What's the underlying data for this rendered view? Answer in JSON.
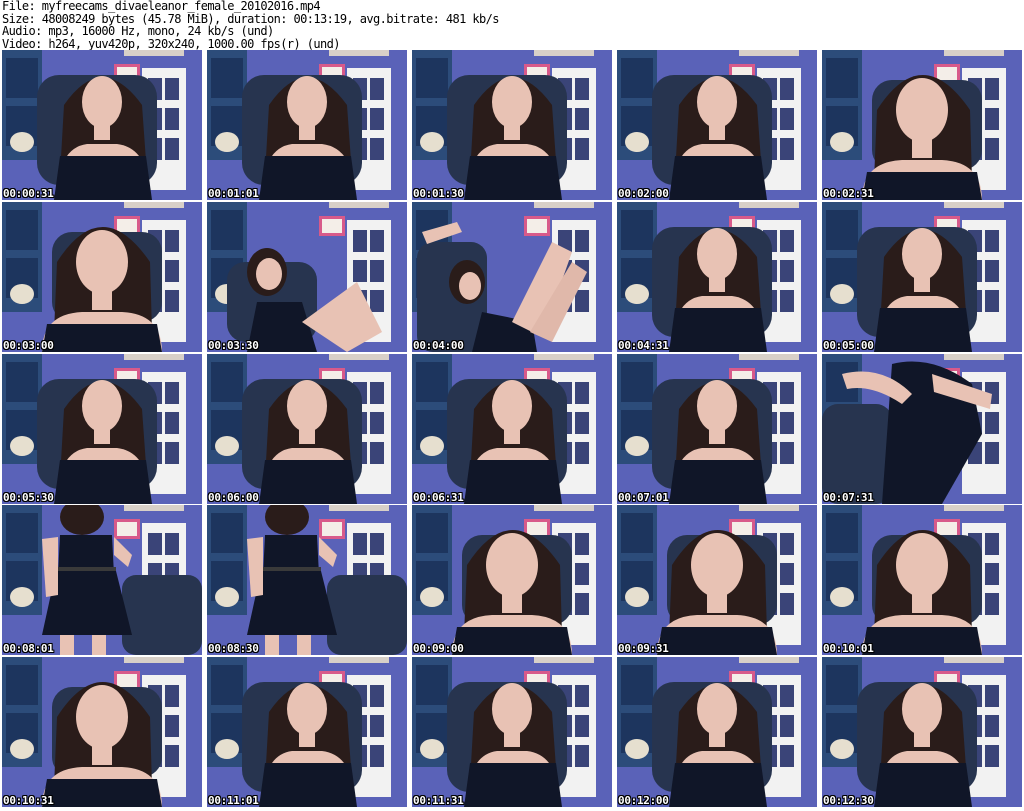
{
  "info": {
    "file": "File: myfreecams_divaeleanor_female_20102016.mp4",
    "size": "Size: 48008249 bytes (45.78 MiB), duration: 00:13:19, avg.bitrate: 481 kb/s",
    "audio": "Audio: mp3, 16000 Hz, mono, 24 kb/s (und)",
    "video": "Video: h264, yuv420p, 320x240, 1000.00 fps(r) (und)"
  },
  "frames": [
    {
      "timestamp": "00:00:31"
    },
    {
      "timestamp": "00:01:01"
    },
    {
      "timestamp": "00:01:30"
    },
    {
      "timestamp": "00:02:00"
    },
    {
      "timestamp": "00:02:31"
    },
    {
      "timestamp": "00:03:00"
    },
    {
      "timestamp": "00:03:30"
    },
    {
      "timestamp": "00:04:00"
    },
    {
      "timestamp": "00:04:31"
    },
    {
      "timestamp": "00:05:00"
    },
    {
      "timestamp": "00:05:30"
    },
    {
      "timestamp": "00:06:00"
    },
    {
      "timestamp": "00:06:31"
    },
    {
      "timestamp": "00:07:01"
    },
    {
      "timestamp": "00:07:31"
    },
    {
      "timestamp": "00:08:01"
    },
    {
      "timestamp": "00:08:30"
    },
    {
      "timestamp": "00:09:00"
    },
    {
      "timestamp": "00:09:31"
    },
    {
      "timestamp": "00:10:01"
    },
    {
      "timestamp": "00:10:31"
    },
    {
      "timestamp": "00:11:01"
    },
    {
      "timestamp": "00:11:31"
    },
    {
      "timestamp": "00:12:00"
    },
    {
      "timestamp": "00:12:30"
    }
  ],
  "colors": {
    "wall": "#5a62b8",
    "shelf": "#f2f2f2",
    "chair": "#27344f",
    "hair": "#2a1c1a",
    "skin": "#e8c2b4",
    "dress": "#101628"
  }
}
